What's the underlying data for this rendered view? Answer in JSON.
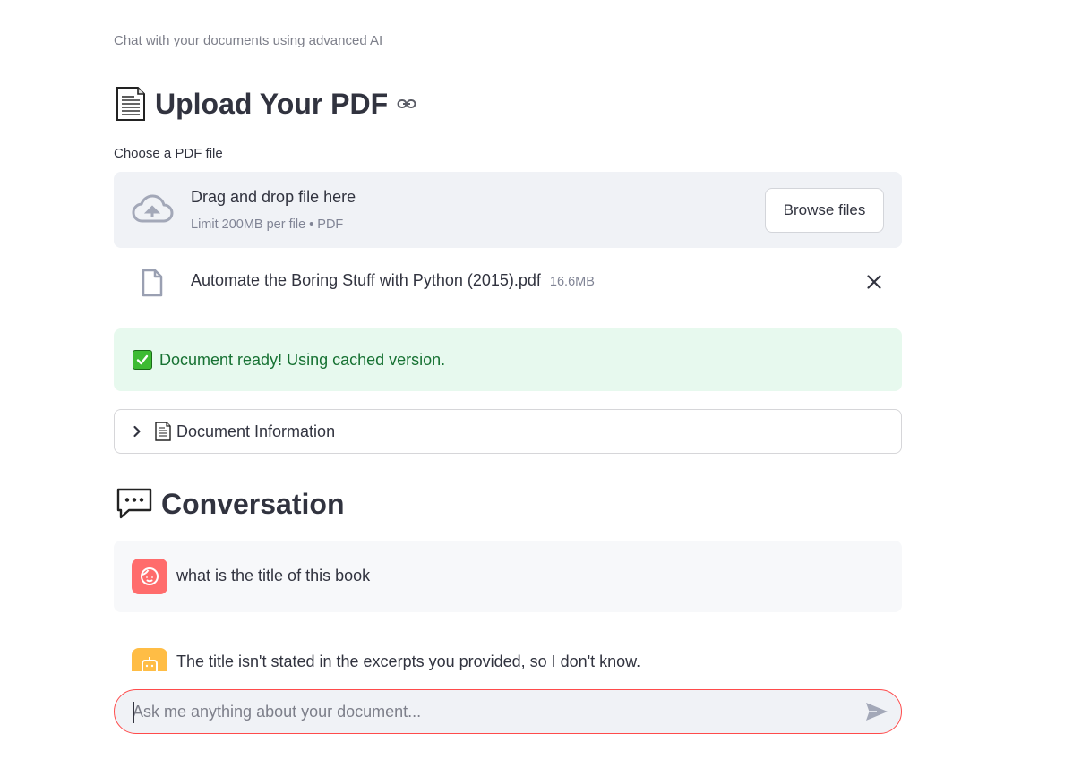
{
  "app": {
    "subtitle": "Chat with your documents using advanced AI"
  },
  "upload_section": {
    "title": "Upload Your PDF",
    "icon": "page-document-icon",
    "link_icon": "link-icon",
    "uploader_label": "Choose a PDF file",
    "dropzone": {
      "main_text": "Drag and drop file here",
      "limit_text": "Limit 200MB per file • PDF",
      "browse_label": "Browse files",
      "icon": "cloud-upload-icon"
    },
    "uploaded_file": {
      "name": "Automate the Boring Stuff with Python (2015).pdf",
      "size": "16.6MB",
      "icon": "file-icon",
      "remove_icon": "close-icon"
    },
    "status": {
      "text": "Document ready! Using cached version.",
      "icon": "check-box-icon",
      "color": "#177233",
      "background": "#e7f9ee"
    },
    "expander": {
      "label": "Document Information",
      "icon": "page-document-icon",
      "expanded": false
    }
  },
  "conversation": {
    "title": "Conversation",
    "icon": "speech-bubble-icon",
    "messages": [
      {
        "role": "user",
        "avatar_color": "#ff6c6c",
        "text": "what is the title of this book"
      },
      {
        "role": "assistant",
        "avatar_color": "#ffbd45",
        "text": "The title isn't stated in the excerpts you provided, so I don't know."
      }
    ]
  },
  "chat_input": {
    "placeholder": "Ask me anything about your document...",
    "value": "",
    "send_icon": "send-icon",
    "border_color": "#ff4b4b"
  }
}
